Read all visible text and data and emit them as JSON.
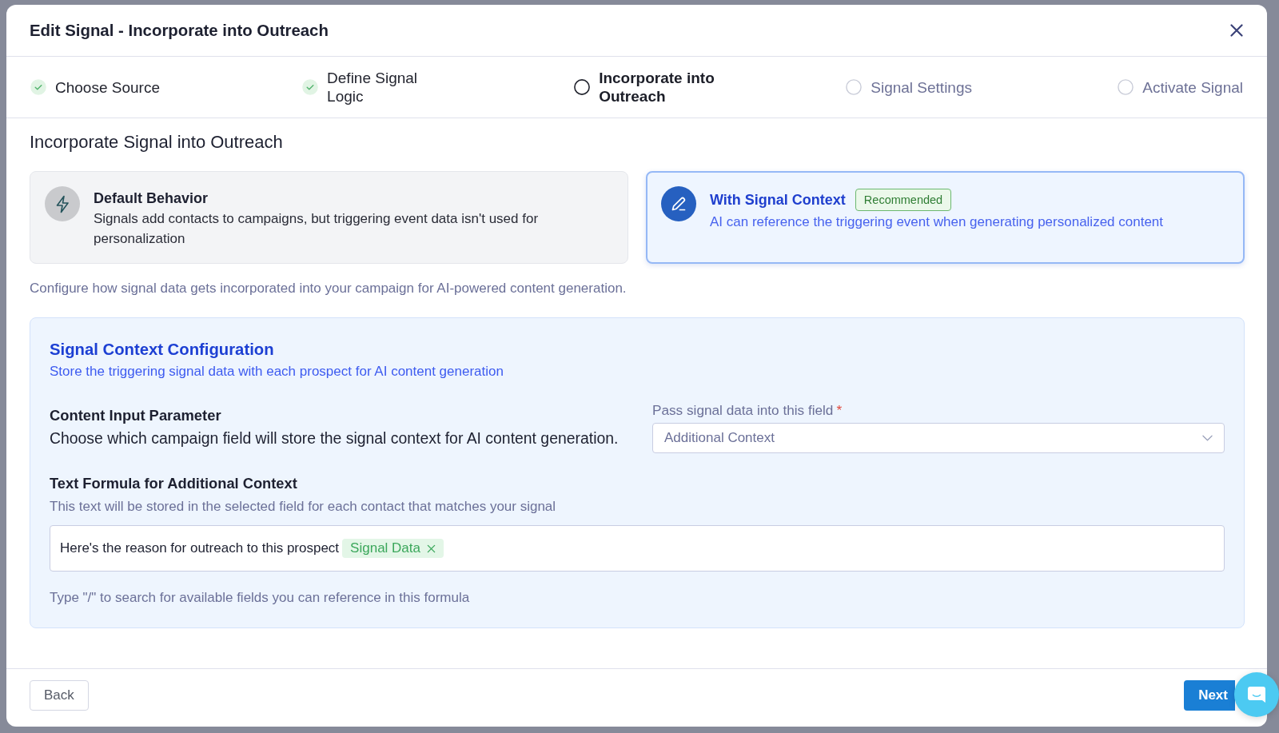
{
  "dialog": {
    "title": "Edit Signal - Incorporate into Outreach"
  },
  "steps": [
    {
      "label": "Choose Source",
      "completed": true,
      "selected": false
    },
    {
      "label": "Define Signal Logic",
      "completed": true,
      "selected": false
    },
    {
      "label": "Incorporate into Outreach",
      "completed": false,
      "selected": true
    },
    {
      "label": "Signal Settings",
      "completed": false,
      "selected": false
    },
    {
      "label": "Activate Signal",
      "completed": false,
      "selected": false
    }
  ],
  "section": {
    "title": "Incorporate Signal into Outreach"
  },
  "options": [
    {
      "kind": "default",
      "title": "Default Behavior",
      "description": "Signals add contacts to campaigns, but triggering event data isn't used for personalization",
      "selected": false
    },
    {
      "kind": "context",
      "title": "With Signal Context",
      "badge": "Recommended",
      "description": "AI can reference the triggering event when generating personalized content",
      "selected": true
    }
  ],
  "hint": "Configure how signal data gets incorporated into your campaign for AI-powered content generation.",
  "config": {
    "title": "Signal Context Configuration",
    "subtitle": "Store the triggering signal data with each prospect for AI content generation",
    "parameter": {
      "title": "Content Input Parameter",
      "description": "Choose which campaign field will store the signal context for AI content generation."
    },
    "field": {
      "label": "Pass signal data into this field",
      "required_mark": "*",
      "value": "Additional Context"
    },
    "formula": {
      "title": "Text Formula for Additional Context",
      "description": "This text will be stored in the selected field for each contact that matches your signal",
      "text": "Here's the reason for outreach to this prospect",
      "tokens": [
        {
          "label": "Signal Data"
        }
      ],
      "help": "Type \"/\" to search for available fields you can reference in this formula"
    }
  },
  "footer": {
    "back": "Back",
    "next": "Next"
  }
}
